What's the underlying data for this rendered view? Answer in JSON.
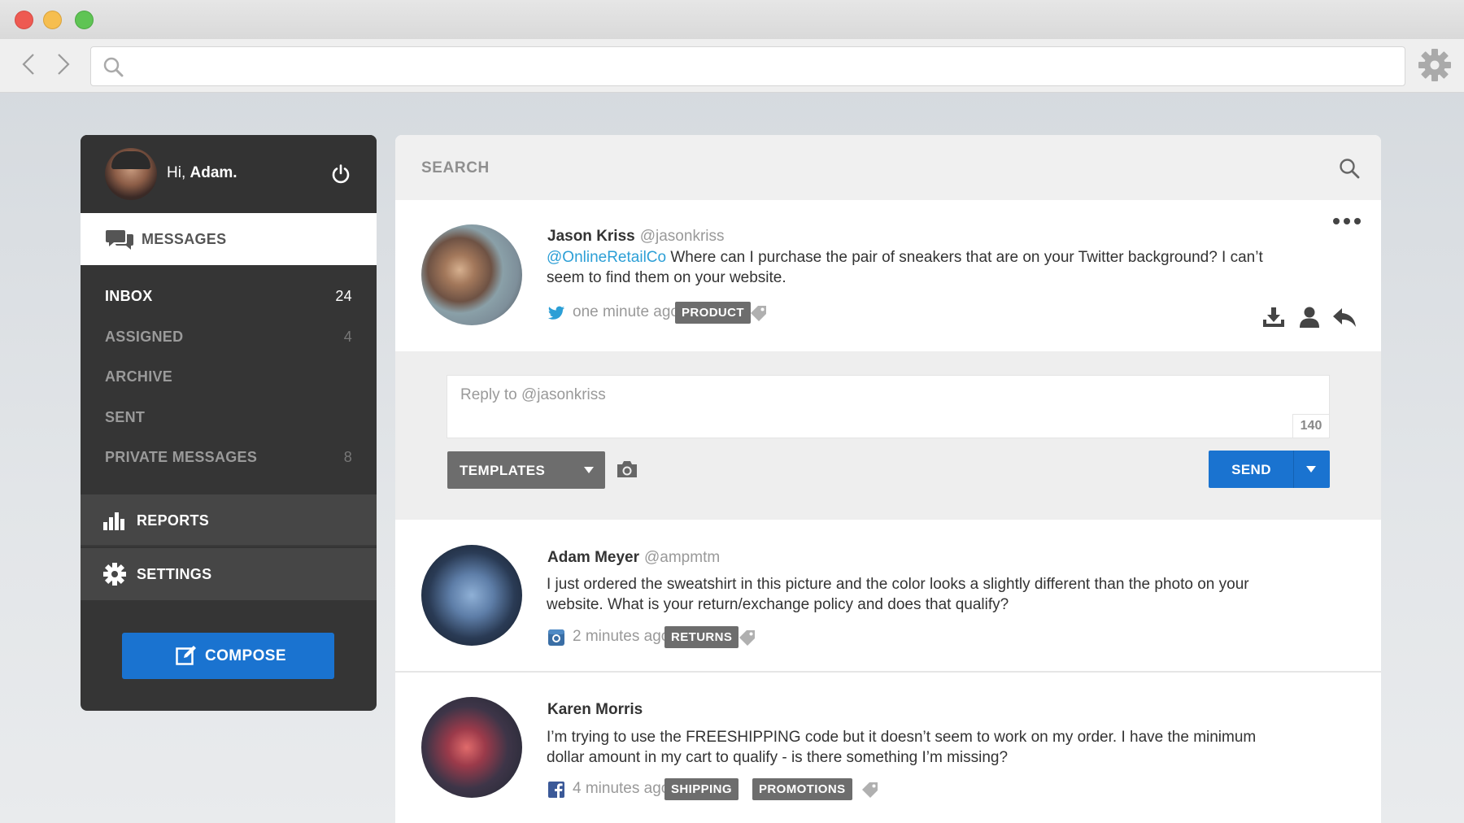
{
  "browser": {
    "url_value": "",
    "icons": [
      "back-arrow-icon",
      "forward-arrow-icon",
      "search-icon",
      "gear-icon"
    ]
  },
  "user": {
    "greeting_prefix": "Hi,",
    "name": "Adam."
  },
  "nav": {
    "messages_label": "MESSAGES",
    "folders": [
      {
        "name": "INBOX",
        "count": "24"
      },
      {
        "name": "ASSIGNED",
        "count": "4"
      },
      {
        "name": "ARCHIVE",
        "count": ""
      },
      {
        "name": "SENT",
        "count": ""
      },
      {
        "name": "PRIVATE MESSAGES",
        "count": "8"
      }
    ],
    "reports_label": "REPORTS",
    "settings_label": "SETTINGS",
    "compose_label": "COMPOSE"
  },
  "search": {
    "label": "SEARCH"
  },
  "messages": [
    {
      "author": "Jason Kriss",
      "handle": "@jasonkriss",
      "mention": "@OnlineRetailCo",
      "text": " Where can I purchase the pair of sneakers that are on your Twitter background? I can’t seem to find them on your website.",
      "source": "twitter-icon",
      "time": "one minute ago",
      "tags": [
        "PRODUCT"
      ]
    },
    {
      "author": "Adam Meyer",
      "handle": "@ampmtm",
      "mention": "",
      "text": "I just ordered the sweatshirt in this picture and the color looks a slightly different than the photo on your website. What is your return/exchange policy and does that qualify?",
      "source": "instagram-icon",
      "time": "2 minutes ago",
      "tags": [
        "RETURNS"
      ]
    },
    {
      "author": "Karen Morris",
      "handle": "",
      "mention": "",
      "text": "I’m trying to use the FREESHIPPING code but it doesn’t seem to work on my order. I have the minimum dollar amount in my cart to qualify - is there something I’m missing?",
      "source": "facebook-icon",
      "time": "4 minutes ago",
      "tags": [
        "SHIPPING",
        "PROMOTIONS"
      ]
    }
  ],
  "reply": {
    "placeholder": "Reply to @jasonkriss",
    "char_count": "140",
    "templates_label": "TEMPLATES",
    "send_label": "SEND"
  },
  "colors": {
    "accent": "#1a73d0",
    "sidebar": "#353535",
    "tag": "#6d6d6d",
    "mention": "#2c9fd6"
  }
}
